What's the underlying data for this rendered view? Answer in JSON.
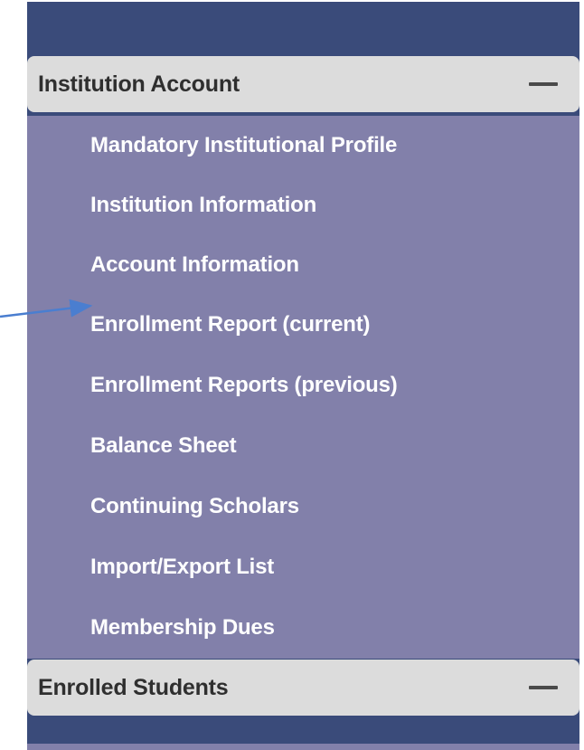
{
  "sidebar": {
    "sections": [
      {
        "title": "Institution Account",
        "collapse_icon": "minus-icon"
      },
      {
        "title": "Enrolled Students",
        "collapse_icon": "minus-icon"
      }
    ],
    "items": [
      {
        "label": "Mandatory Institutional Profile"
      },
      {
        "label": "Institution Information"
      },
      {
        "label": "Account Information"
      },
      {
        "label": "Enrollment Report (current)"
      },
      {
        "label": "Enrollment Reports (previous)"
      },
      {
        "label": "Balance Sheet"
      },
      {
        "label": "Continuing Scholars"
      },
      {
        "label": "Import/Export List"
      },
      {
        "label": "Membership Dues"
      }
    ]
  },
  "colors": {
    "sidebar_background": "#3a4b7a",
    "menu_background": "#8280aa",
    "section_header_background": "#dcdcdc",
    "menu_text": "#ffffff",
    "annotation_arrow": "#4a7ed0"
  },
  "annotation": {
    "icon": "arrow-right-icon",
    "target": "Enrollment Report (current)"
  }
}
